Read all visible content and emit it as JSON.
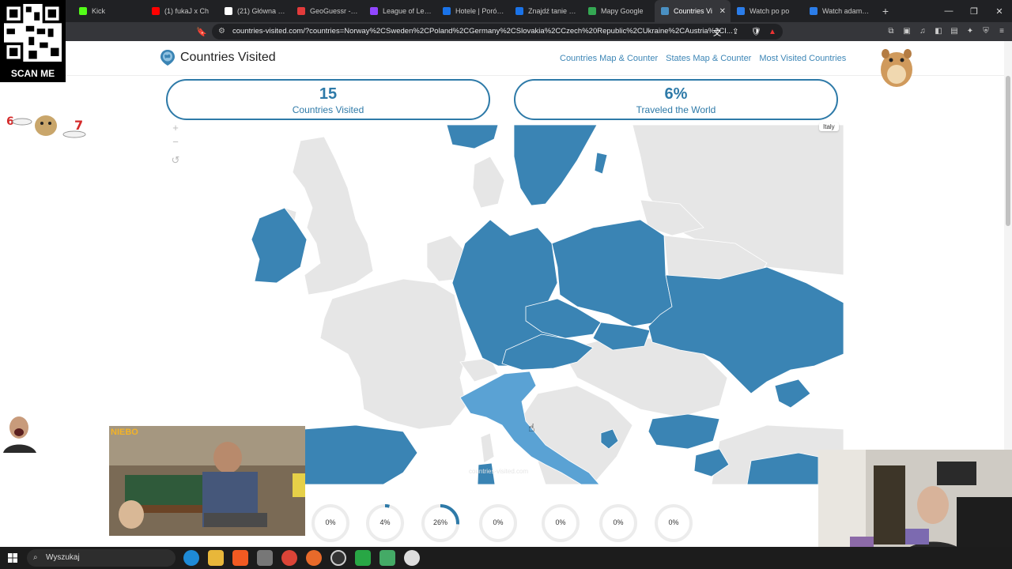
{
  "browser": {
    "tabs": [
      {
        "label": "",
        "color": "#222222"
      },
      {
        "label": "Kick",
        "color": "#53fc18"
      },
      {
        "label": "(1) fukaJ x Ch",
        "color": "#ff0000"
      },
      {
        "label": "(21) Główna / X",
        "color": "#ffffff"
      },
      {
        "label": "GeoGuessr - Let's",
        "color": "#e33b3b"
      },
      {
        "label": "League of Legen",
        "color": "#9146ff"
      },
      {
        "label": "Hotele | Porówn",
        "color": "#1a73e8"
      },
      {
        "label": "Znajdź tanie loty",
        "color": "#1a73e8"
      },
      {
        "label": "Mapy Google",
        "color": "#34a853"
      },
      {
        "label": "Countries Vi",
        "color": "#4a90c2"
      },
      {
        "label": "Watch po po",
        "color": "#2b7de9"
      },
      {
        "label": "Watch adamczyk",
        "color": "#2b7de9"
      }
    ],
    "active_tab_index": 9,
    "url": "countries-visited.com/?countries=Norway%2CSweden%2CPoland%2CGermany%2CSlovakia%2CCzech%20Republic%2CUkraine%2CAustria%2CI..."
  },
  "site": {
    "brand": "Countries Visited",
    "nav": [
      "Countries Map & Counter",
      "States Map & Counter",
      "Most Visited Countries"
    ],
    "stats": [
      {
        "value": "15",
        "label": "Countries Visited"
      },
      {
        "value": "6%",
        "label": "Traveled the World"
      }
    ],
    "map": {
      "tooltip": "Italy",
      "zoom_in": "+",
      "zoom_out": "−",
      "reset": "↺",
      "watermark": "countries-visited.com",
      "visited_color": "#3a84b4",
      "hover_color": "#5aa2d4",
      "unvisited_color": "#e6e6e6"
    },
    "continent_progress": [
      {
        "pct": "0%",
        "value": 0
      },
      {
        "pct": "4%",
        "value": 4
      },
      {
        "pct": "26%",
        "value": 26
      },
      {
        "pct": "0%",
        "value": 0
      },
      {
        "pct": "0%",
        "value": 0
      },
      {
        "pct": "0%",
        "value": 0
      },
      {
        "pct": "0%",
        "value": 0
      }
    ]
  },
  "overlays": {
    "qr_label": "SCAN ME",
    "video_caption": "NIEBO"
  },
  "taskbar": {
    "search_placeholder": "Wyszukaj"
  }
}
